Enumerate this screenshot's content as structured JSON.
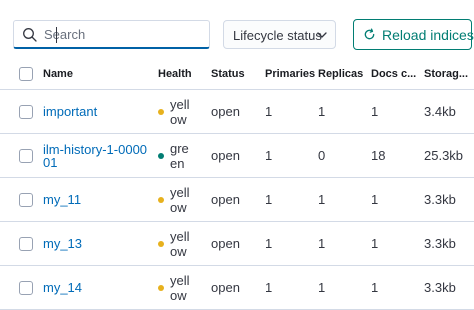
{
  "search": {
    "placeholder": "Search",
    "value": ""
  },
  "filters": {
    "lifecycle_label": "Lifecycle status"
  },
  "actions": {
    "reload_label": "Reload indices"
  },
  "table": {
    "headers": {
      "name": "Name",
      "health": "Health",
      "status": "Status",
      "primaries": "Primaries",
      "replicas": "Replicas",
      "docs": "Docs c...",
      "storage": "Storag..."
    },
    "rows": [
      {
        "name": "important",
        "health": "yellow",
        "status": "open",
        "primaries": "1",
        "replicas": "1",
        "docs": "1",
        "storage": "3.4kb"
      },
      {
        "name": "ilm-history-1-000001",
        "health": "green",
        "status": "open",
        "primaries": "1",
        "replicas": "0",
        "docs": "18",
        "storage": "25.3kb"
      },
      {
        "name": "my_11",
        "health": "yellow",
        "status": "open",
        "primaries": "1",
        "replicas": "1",
        "docs": "1",
        "storage": "3.3kb"
      },
      {
        "name": "my_13",
        "health": "yellow",
        "status": "open",
        "primaries": "1",
        "replicas": "1",
        "docs": "1",
        "storage": "3.3kb"
      },
      {
        "name": "my_14",
        "health": "yellow",
        "status": "open",
        "primaries": "1",
        "replicas": "1",
        "docs": "1",
        "storage": "3.3kb"
      }
    ]
  },
  "colors": {
    "yellow": "#e7b11d",
    "green": "#017d73",
    "link": "#006bb8",
    "accent": "#017d73"
  },
  "icons": {
    "search": "search-icon",
    "chevron": "chevron-down-icon",
    "reload": "refresh-icon"
  }
}
